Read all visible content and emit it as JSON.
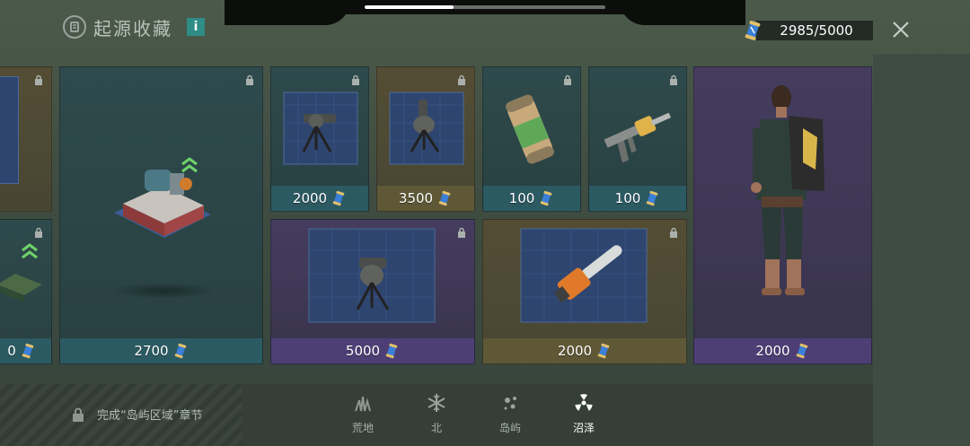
{
  "top_progress": {
    "fraction": 0.37
  },
  "header": {
    "title": "起源收藏",
    "info_label": "i",
    "icon": "origin-emblem-icon"
  },
  "currency": {
    "amount": "2985/5000",
    "icon": "blueprint-scroll-icon"
  },
  "close": {
    "icon": "close-icon",
    "label": "关闭"
  },
  "colors": {
    "teal": "#2c5a62",
    "olive": "#5f5836",
    "purple": "#4d3f76",
    "info": "#2f8c86"
  },
  "cards": [
    {
      "id": "partial-left-top",
      "price": "",
      "theme": "olive"
    },
    {
      "id": "partial-left-bottom",
      "price": "0",
      "theme": "teal"
    },
    {
      "id": "workbench",
      "price": "2700",
      "theme": "teal",
      "icon": "workbench-upgrade-icon"
    },
    {
      "id": "turret-1",
      "price": "2000",
      "theme": "teal",
      "icon": "turret-blueprint-icon"
    },
    {
      "id": "turret-2",
      "price": "3500",
      "theme": "olive",
      "icon": "turret-blueprint-icon"
    },
    {
      "id": "canister",
      "price": "100",
      "theme": "teal",
      "count": "1",
      "icon": "fuel-canister-icon"
    },
    {
      "id": "nozzle",
      "price": "100",
      "theme": "teal",
      "count": "1",
      "icon": "spray-nozzle-icon"
    },
    {
      "id": "turret-3",
      "price": "5000",
      "theme": "purple",
      "icon": "turret-blueprint-icon"
    },
    {
      "id": "chainsaw",
      "price": "2000",
      "theme": "olive",
      "icon": "chainsaw-blueprint-icon"
    },
    {
      "id": "character",
      "price": "2000",
      "theme": "purple",
      "icon": "survivor-backpack-icon"
    }
  ],
  "footer": {
    "chapter_text": "完成“岛屿区域”章节",
    "regions": [
      {
        "label": "荒地",
        "icon": "grass-icon",
        "active": false
      },
      {
        "label": "北",
        "icon": "snowflake-icon",
        "active": false
      },
      {
        "label": "岛屿",
        "icon": "sparkle-icon",
        "active": false
      },
      {
        "label": "沼泽",
        "icon": "radiation-icon",
        "active": true
      }
    ]
  }
}
